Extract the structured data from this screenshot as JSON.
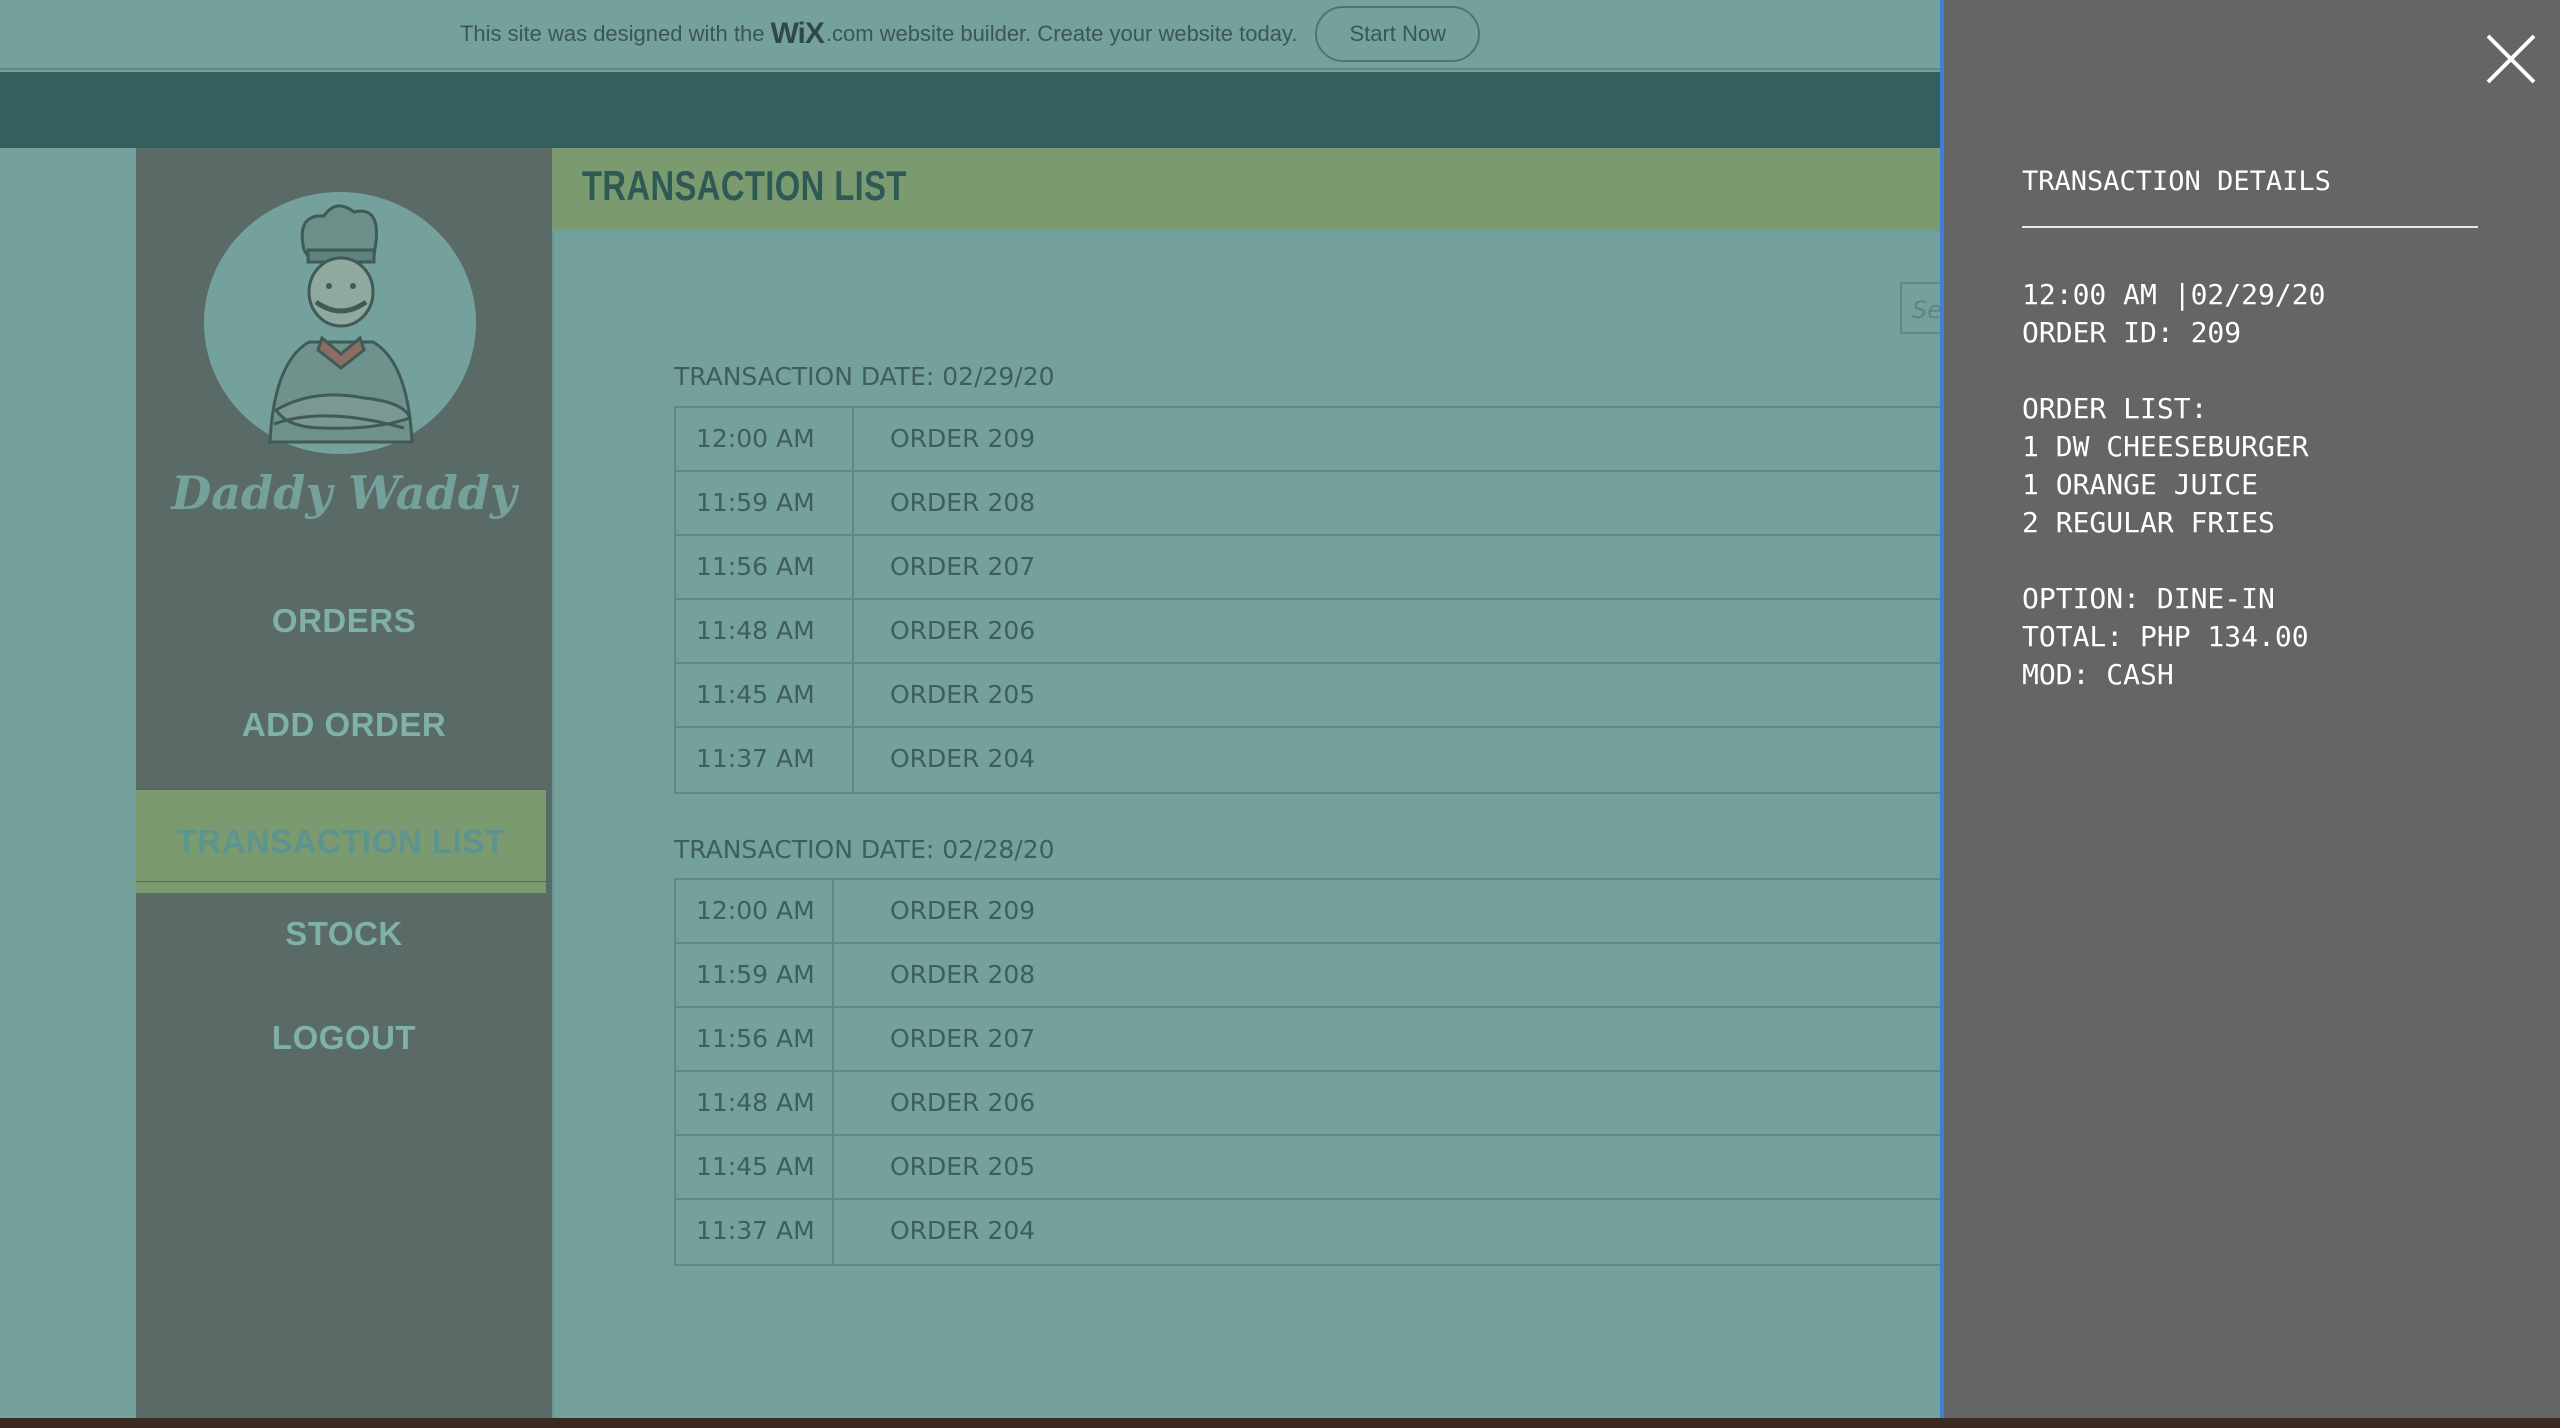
{
  "banner": {
    "text_before": "This site was designed with the",
    "wix_logo": "WiX",
    "text_after": ".com website builder. Create your website today.",
    "start_button": "Start Now"
  },
  "sidebar": {
    "brand": "Daddy Waddy",
    "items": [
      {
        "label": "ORDERS",
        "active": false
      },
      {
        "label": "ADD ORDER",
        "active": false
      },
      {
        "label": "TRANSACTION LIST",
        "active": true
      },
      {
        "label": "STOCK",
        "active": false
      },
      {
        "label": "LOGOUT",
        "active": false
      }
    ]
  },
  "main": {
    "title": "TRANSACTION LIST",
    "search_placeholder": "Se",
    "groups": [
      {
        "date_label": "TRANSACTION DATE: 02/29/20",
        "rows": [
          {
            "time": "12:00 AM",
            "order": "ORDER 209"
          },
          {
            "time": "11:59 AM",
            "order": "ORDER 208"
          },
          {
            "time": "11:56 AM",
            "order": "ORDER 207"
          },
          {
            "time": "11:48 AM",
            "order": "ORDER 206"
          },
          {
            "time": "11:45 AM",
            "order": "ORDER 205"
          },
          {
            "time": "11:37 AM",
            "order": "ORDER 204"
          }
        ]
      },
      {
        "date_label": "TRANSACTION DATE: 02/28/20",
        "rows": [
          {
            "time": "12:00 AM",
            "order": "ORDER 209"
          },
          {
            "time": "11:59 AM",
            "order": "ORDER 208"
          },
          {
            "time": "11:56 AM",
            "order": "ORDER 207"
          },
          {
            "time": "11:48 AM",
            "order": "ORDER 206"
          },
          {
            "time": "11:45 AM",
            "order": "ORDER 205"
          },
          {
            "time": "11:37 AM",
            "order": "ORDER 204"
          }
        ]
      }
    ]
  },
  "details": {
    "heading": "TRANSACTION DETAILS",
    "datetime": "12:00 AM |02/29/20",
    "order_id": "ORDER ID: 209",
    "order_list_label": "ORDER LIST:",
    "items": [
      "1 DW CHEESEBURGER",
      "1 ORANGE JUICE",
      "2 REGULAR FRIES"
    ],
    "option": "OPTION: DINE-IN",
    "total": "TOTAL: PHP 134.00",
    "mod": "MOD: CASH"
  },
  "colors": {
    "overlay_teal": "#74a19c",
    "accent_green": "#7b9a70",
    "panel_gray": "#656565",
    "panel_border": "#3d7fd8"
  },
  "icons": {
    "close": "close-icon",
    "chef": "chef-mascot-icon"
  }
}
